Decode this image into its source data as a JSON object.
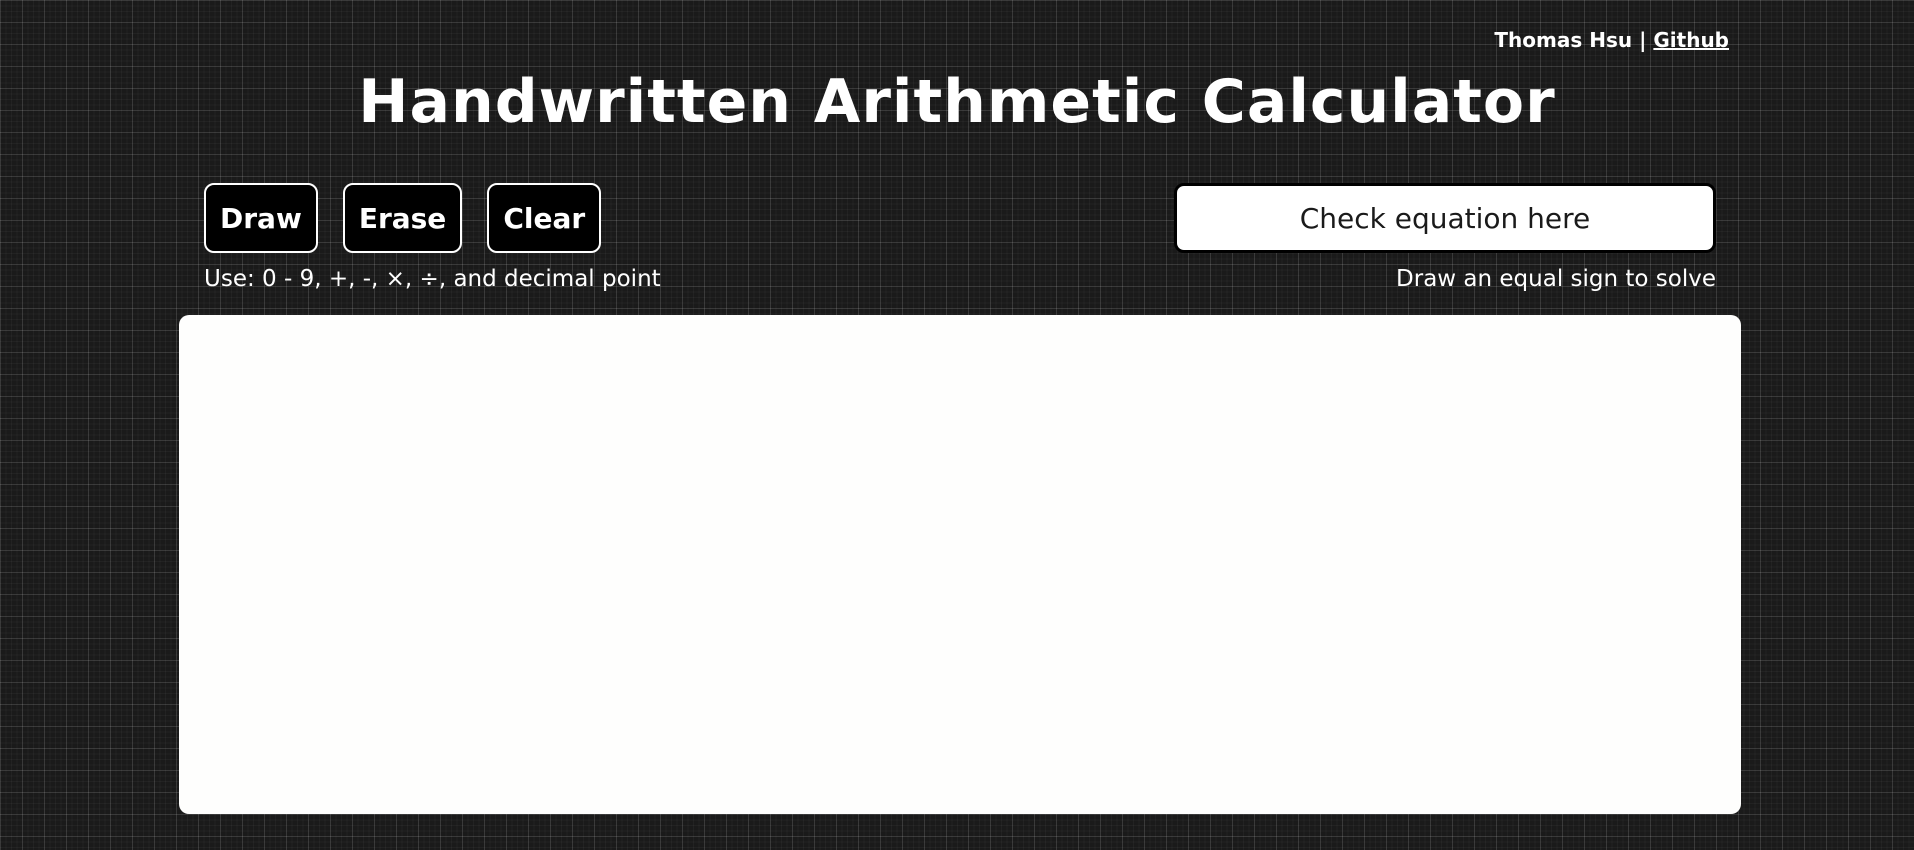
{
  "header": {
    "author_name": "Thomas Hsu",
    "separator": "|",
    "github_link": "Github",
    "title": "Handwritten Arithmetic Calculator"
  },
  "toolbar": {
    "draw_label": "Draw",
    "erase_label": "Erase",
    "clear_label": "Clear",
    "usage_hint": "Use: 0 - 9, +, -, ×, ÷, and decimal point"
  },
  "equation": {
    "placeholder": "Check equation here",
    "value": "",
    "hint": "Draw an equal sign to solve"
  },
  "colors": {
    "background": "#1a1a1a",
    "canvas": "#fefefd",
    "button_bg": "#000000",
    "text": "#ffffff"
  }
}
